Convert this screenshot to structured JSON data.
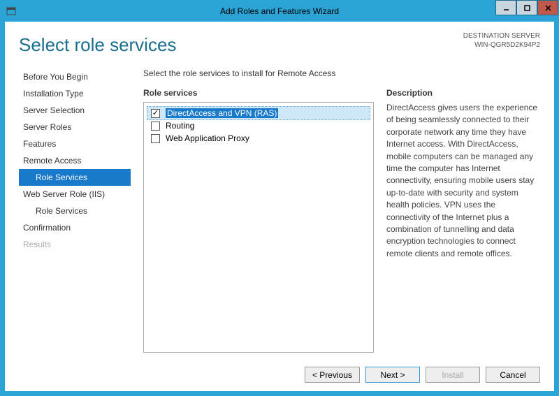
{
  "window": {
    "title": "Add Roles and Features Wizard"
  },
  "destination": {
    "label": "DESTINATION SERVER",
    "server": "WIN-QGR5D2K94P2"
  },
  "page": {
    "title": "Select role services",
    "instruction": "Select the role services to install for Remote Access"
  },
  "nav": {
    "items": [
      {
        "label": "Before You Begin",
        "sub": false,
        "active": false,
        "disabled": false
      },
      {
        "label": "Installation Type",
        "sub": false,
        "active": false,
        "disabled": false
      },
      {
        "label": "Server Selection",
        "sub": false,
        "active": false,
        "disabled": false
      },
      {
        "label": "Server Roles",
        "sub": false,
        "active": false,
        "disabled": false
      },
      {
        "label": "Features",
        "sub": false,
        "active": false,
        "disabled": false
      },
      {
        "label": "Remote Access",
        "sub": false,
        "active": false,
        "disabled": false
      },
      {
        "label": "Role Services",
        "sub": true,
        "active": true,
        "disabled": false
      },
      {
        "label": "Web Server Role (IIS)",
        "sub": false,
        "active": false,
        "disabled": false
      },
      {
        "label": "Role Services",
        "sub": true,
        "active": false,
        "disabled": false
      },
      {
        "label": "Confirmation",
        "sub": false,
        "active": false,
        "disabled": false
      },
      {
        "label": "Results",
        "sub": false,
        "active": false,
        "disabled": true
      }
    ]
  },
  "roleServices": {
    "heading": "Role services",
    "items": [
      {
        "label": "DirectAccess and VPN (RAS)",
        "checked": true,
        "selected": true
      },
      {
        "label": "Routing",
        "checked": false,
        "selected": false
      },
      {
        "label": "Web Application Proxy",
        "checked": false,
        "selected": false
      }
    ]
  },
  "description": {
    "heading": "Description",
    "text": "DirectAccess gives users the experience of being seamlessly connected to their corporate network any time they have Internet access. With DirectAccess, mobile computers can be managed any time the computer has Internet connectivity, ensuring mobile users stay up-to-date with security and system health policies. VPN uses the connectivity of the Internet plus a combination of tunnelling and data encryption technologies to connect remote clients and remote offices."
  },
  "buttons": {
    "previous": "< Previous",
    "next": "Next >",
    "install": "Install",
    "cancel": "Cancel"
  }
}
